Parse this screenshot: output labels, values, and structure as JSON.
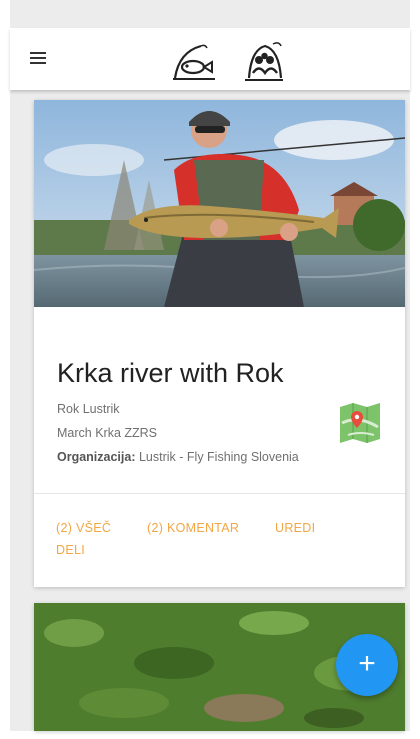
{
  "appbar": {
    "menu_icon": "hamburger-menu-icon",
    "logos": [
      "fishing-rod-fish-logo",
      "people-group-logo"
    ]
  },
  "post": {
    "title": "Krka river with Rok",
    "author": "Rok Lustrik",
    "location": "March Krka ZZRS",
    "organization_label": "Organizacija:",
    "organization": "Lustrik - Fly Fishing Slovenia",
    "map_icon": "map-location-icon",
    "actions": {
      "like": "(2) VŠEČ",
      "comment": "(2) KOMENTAR",
      "edit": "UREDI",
      "share": "DELI"
    }
  },
  "fab": {
    "label": "+"
  },
  "colors": {
    "accent": "#f2a644",
    "fab": "#2196f3",
    "background": "#ececec"
  }
}
